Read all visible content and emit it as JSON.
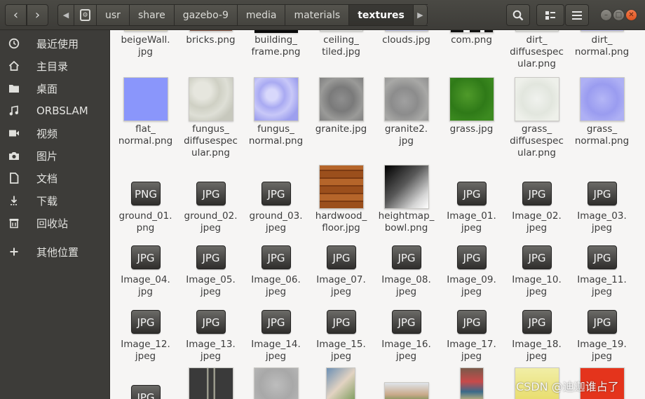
{
  "header": {
    "breadcrumbs": [
      "usr",
      "share",
      "gazebo-9",
      "media",
      "materials",
      "textures"
    ]
  },
  "sidebar": {
    "items": [
      {
        "label": "最近使用",
        "icon": "clock-icon"
      },
      {
        "label": "主目录",
        "icon": "home-icon"
      },
      {
        "label": "桌面",
        "icon": "folder-icon"
      },
      {
        "label": "ORBSLAM",
        "icon": "music-icon"
      },
      {
        "label": "视频",
        "icon": "video-icon"
      },
      {
        "label": "图片",
        "icon": "camera-icon"
      },
      {
        "label": "文档",
        "icon": "document-icon"
      },
      {
        "label": "下载",
        "icon": "download-icon"
      },
      {
        "label": "回收站",
        "icon": "trash-icon"
      },
      {
        "label": "其他位置",
        "icon": "plus-icon"
      }
    ]
  },
  "files": {
    "row0": [
      {
        "name": "beigeWall.\njpg"
      },
      {
        "name": "bricks.png"
      },
      {
        "name": "building_\nframe.png"
      },
      {
        "name": "ceiling_\ntiled.jpg"
      },
      {
        "name": "clouds.jpg"
      },
      {
        "name": "com.png"
      },
      {
        "name": "dirt_\ndiffusespec\nular.png"
      },
      {
        "name": "dirt_\nnormal.png"
      }
    ],
    "row1": [
      {
        "name": "flat_\nnormal.png"
      },
      {
        "name": "fungus_\ndiffusespec\nular.png"
      },
      {
        "name": "fungus_\nnormal.png"
      },
      {
        "name": "granite.jpg"
      },
      {
        "name": "granite2.\njpg"
      },
      {
        "name": "grass.jpg"
      },
      {
        "name": "grass_\ndiffusespec\nular.png"
      },
      {
        "name": "grass_\nnormal.png"
      }
    ],
    "row2": [
      {
        "name": "ground_01.\npng",
        "badge": "PNG"
      },
      {
        "name": "ground_02.\njpeg",
        "badge": "JPG"
      },
      {
        "name": "ground_03.\njpeg",
        "badge": "JPG"
      },
      {
        "name": "hardwood_\nfloor.jpg"
      },
      {
        "name": "heightmap_\nbowl.png"
      },
      {
        "name": "Image_01.\njpeg",
        "badge": "JPG"
      },
      {
        "name": "Image_02.\njpeg",
        "badge": "JPG"
      },
      {
        "name": "Image_03.\njpeg",
        "badge": "JPG"
      }
    ],
    "row3": [
      {
        "name": "Image_04.\njpg",
        "badge": "JPG"
      },
      {
        "name": "Image_05.\njpeg",
        "badge": "JPG"
      },
      {
        "name": "Image_06.\njpeg",
        "badge": "JPG"
      },
      {
        "name": "Image_07.\njpeg",
        "badge": "JPG"
      },
      {
        "name": "Image_08.\njpeg",
        "badge": "JPG"
      },
      {
        "name": "Image_09.\njpeg",
        "badge": "JPG"
      },
      {
        "name": "Image_10.\njpeg",
        "badge": "JPG"
      },
      {
        "name": "Image_11.\njpeg",
        "badge": "JPG"
      }
    ],
    "row4": [
      {
        "name": "Image_12.\njpeg",
        "badge": "JPG"
      },
      {
        "name": "Image_13.\njpeg",
        "badge": "JPG"
      },
      {
        "name": "Image_14.\njpeg",
        "badge": "JPG"
      },
      {
        "name": "Image_15.\njpeg",
        "badge": "JPG"
      },
      {
        "name": "Image_16.\njpeg",
        "badge": "JPG"
      },
      {
        "name": "Image_17.\njpeg",
        "badge": "JPG"
      },
      {
        "name": "Image_18.\njpeg",
        "badge": "JPG"
      },
      {
        "name": "Image_19.\njpeg",
        "badge": "JPG"
      }
    ],
    "row5": [
      {
        "badge": "JPG"
      }
    ]
  },
  "watermark": "CSDN @迪迦谁占了"
}
